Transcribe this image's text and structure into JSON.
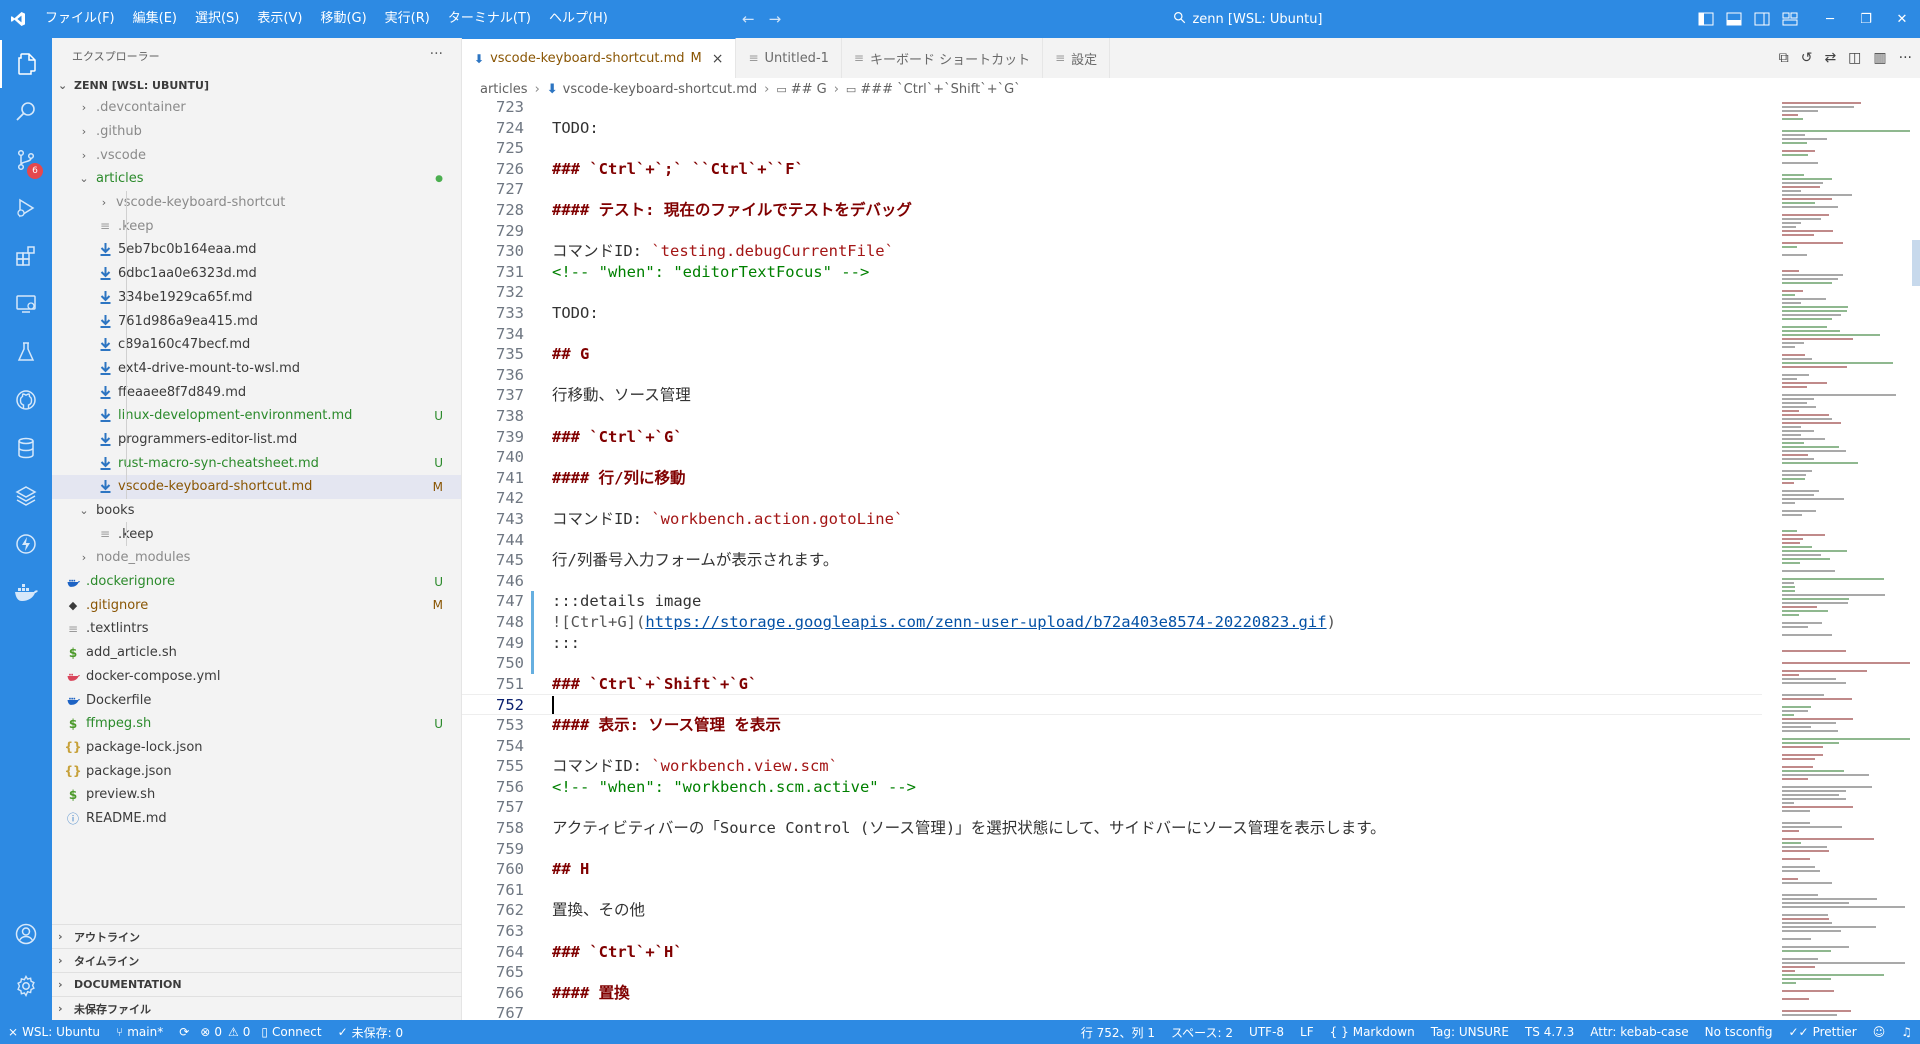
{
  "window": {
    "title": "zenn [WSL: Ubuntu]",
    "menu": [
      "ファイル(F)",
      "編集(E)",
      "選択(S)",
      "表示(V)",
      "移動(G)",
      "実行(R)",
      "ターミナル(T)",
      "ヘルプ(H)"
    ]
  },
  "activity_bar": {
    "items": [
      "explorer-icon",
      "search-icon",
      "source-control-icon",
      "run-debug-icon",
      "extensions-icon",
      "remote-explorer-icon",
      "testing-icon",
      "github-icon",
      "database-icon",
      "layers-icon",
      "thunder-icon",
      "docker-icon"
    ],
    "scm_badge": "6",
    "bottom": [
      "account-icon",
      "settings-gear-icon"
    ]
  },
  "sidebar": {
    "title": "エクスプローラー",
    "more": "···",
    "root": "ZENN [WSL: UBUNTU]",
    "tree": [
      {
        "label": ".devcontainer",
        "type": "folder",
        "open": false,
        "depth": 0,
        "color": "dim"
      },
      {
        "label": ".github",
        "type": "folder",
        "open": false,
        "depth": 0,
        "color": "dim"
      },
      {
        "label": ".vscode",
        "type": "folder",
        "open": false,
        "depth": 0,
        "color": "dim"
      },
      {
        "label": "articles",
        "type": "folder",
        "open": true,
        "depth": 0,
        "color": "green",
        "status": "●"
      },
      {
        "label": "vscode-keyboard-shortcut",
        "type": "folder",
        "open": false,
        "depth": 1,
        "color": "dim"
      },
      {
        "label": ".keep",
        "type": "keep",
        "depth": 1,
        "color": "dim"
      },
      {
        "label": "5eb7bc0b164eaa.md",
        "type": "md",
        "depth": 1,
        "color": "dk"
      },
      {
        "label": "6dbc1aa0e6323d.md",
        "type": "md",
        "depth": 1,
        "color": "dk"
      },
      {
        "label": "334be1929ca65f.md",
        "type": "md",
        "depth": 1,
        "color": "dk"
      },
      {
        "label": "761d986a9ea415.md",
        "type": "md",
        "depth": 1,
        "color": "dk"
      },
      {
        "label": "c89a160c47becf.md",
        "type": "md",
        "depth": 1,
        "color": "dk"
      },
      {
        "label": "ext4-drive-mount-to-wsl.md",
        "type": "md",
        "depth": 1,
        "color": "dk"
      },
      {
        "label": "ffeaaee8f7d849.md",
        "type": "md",
        "depth": 1,
        "color": "dk"
      },
      {
        "label": "linux-development-environment.md",
        "type": "md",
        "depth": 1,
        "color": "green",
        "status": "U"
      },
      {
        "label": "programmers-editor-list.md",
        "type": "md",
        "depth": 1,
        "color": "dk"
      },
      {
        "label": "rust-macro-syn-cheatsheet.md",
        "type": "md",
        "depth": 1,
        "color": "green",
        "status": "U"
      },
      {
        "label": "vscode-keyboard-shortcut.md",
        "type": "md",
        "depth": 1,
        "color": "mod",
        "status": "M",
        "selected": true
      },
      {
        "label": "books",
        "type": "folder",
        "open": true,
        "depth": 0,
        "color": "dk"
      },
      {
        "label": ".keep",
        "type": "keep",
        "depth": 1,
        "color": "dk"
      },
      {
        "label": "node_modules",
        "type": "folder",
        "open": false,
        "depth": 0,
        "color": "dim"
      },
      {
        "label": ".dockerignore",
        "type": "docker",
        "depth": 0,
        "color": "green",
        "status": "U"
      },
      {
        "label": ".gitignore",
        "type": "git",
        "depth": 0,
        "color": "mod",
        "status": "M"
      },
      {
        "label": ".textlintrs",
        "type": "keep",
        "depth": 0,
        "color": "dk"
      },
      {
        "label": "add_article.sh",
        "type": "sh",
        "depth": 0,
        "color": "dk"
      },
      {
        "label": "docker-compose.yml",
        "type": "compose",
        "depth": 0,
        "color": "dk"
      },
      {
        "label": "Dockerfile",
        "type": "docker",
        "depth": 0,
        "color": "dk"
      },
      {
        "label": "ffmpeg.sh",
        "type": "sh",
        "depth": 0,
        "color": "green",
        "status": "U"
      },
      {
        "label": "package-lock.json",
        "type": "json",
        "depth": 0,
        "color": "dk"
      },
      {
        "label": "package.json",
        "type": "json",
        "depth": 0,
        "color": "dk"
      },
      {
        "label": "preview.sh",
        "type": "sh",
        "depth": 0,
        "color": "dk"
      },
      {
        "label": "README.md",
        "type": "info",
        "depth": 0,
        "color": "dk"
      }
    ],
    "sections": [
      "アウトライン",
      "タイムライン",
      "DOCUMENTATION",
      "未保存ファイル"
    ]
  },
  "tabs": [
    {
      "label": "vscode-keyboard-shortcut.md",
      "status": "M",
      "icon": "markdown-icon",
      "active": true,
      "close": "×"
    },
    {
      "label": "Untitled-1",
      "icon": "file-icon",
      "active": false
    },
    {
      "label": "キーボード ショートカット",
      "icon": "keyboard-icon",
      "active": false
    },
    {
      "label": "設定",
      "icon": "settings-icon",
      "active": false
    }
  ],
  "breadcrumb": [
    "articles",
    "vscode-keyboard-shortcut.md",
    "## G",
    "### `Ctrl`+`Shift`+`G`"
  ],
  "editor": {
    "current_line": 752,
    "modified_lines": [
      747,
      748,
      749,
      750
    ],
    "lines": [
      {
        "n": 723,
        "t": "",
        "k": "p"
      },
      {
        "n": 724,
        "t": "TODO:",
        "k": "p"
      },
      {
        "n": 725,
        "t": "",
        "k": "p"
      },
      {
        "n": 726,
        "t": "### `Ctrl`+`;` ``Ctrl`+``F`",
        "k": "h"
      },
      {
        "n": 727,
        "t": "",
        "k": "p"
      },
      {
        "n": 728,
        "t": "#### テスト: 現在のファイルでテストをデバッグ",
        "k": "h"
      },
      {
        "n": 729,
        "t": "",
        "k": "p"
      },
      {
        "n": 730,
        "t": "コマンドID: ",
        "code": "`testing.debugCurrentFile`",
        "k": "cmd"
      },
      {
        "n": 731,
        "t": "<!-- \"when\": \"editorTextFocus\" -->",
        "k": "c"
      },
      {
        "n": 732,
        "t": "",
        "k": "p"
      },
      {
        "n": 733,
        "t": "TODO:",
        "k": "p"
      },
      {
        "n": 734,
        "t": "",
        "k": "p"
      },
      {
        "n": 735,
        "t": "## G",
        "k": "h"
      },
      {
        "n": 736,
        "t": "",
        "k": "p"
      },
      {
        "n": 737,
        "t": "行移動、ソース管理",
        "k": "p"
      },
      {
        "n": 738,
        "t": "",
        "k": "p"
      },
      {
        "n": 739,
        "t": "### `Ctrl`+`G`",
        "k": "h"
      },
      {
        "n": 740,
        "t": "",
        "k": "p"
      },
      {
        "n": 741,
        "t": "#### 行/列に移動",
        "k": "h"
      },
      {
        "n": 742,
        "t": "",
        "k": "p"
      },
      {
        "n": 743,
        "t": "コマンドID: ",
        "code": "`workbench.action.gotoLine`",
        "k": "cmd"
      },
      {
        "n": 744,
        "t": "",
        "k": "p"
      },
      {
        "n": 745,
        "t": "行/列番号入力フォームが表示されます。",
        "k": "p"
      },
      {
        "n": 746,
        "t": "",
        "k": "p"
      },
      {
        "n": 747,
        "t": ":::details image",
        "k": "p"
      },
      {
        "n": 748,
        "t": "![Ctrl+G](",
        "link": "https://storage.googleapis.com/zenn-user-upload/b72a403e8574-20220823.gif",
        "after": ")",
        "k": "img"
      },
      {
        "n": 749,
        "t": ":::",
        "k": "p"
      },
      {
        "n": 750,
        "t": "",
        "k": "p"
      },
      {
        "n": 751,
        "t": "### `Ctrl`+`Shift`+`G`",
        "k": "h"
      },
      {
        "n": 752,
        "t": "",
        "k": "p"
      },
      {
        "n": 753,
        "t": "#### 表示: ソース管理 を表示",
        "k": "h"
      },
      {
        "n": 754,
        "t": "",
        "k": "p"
      },
      {
        "n": 755,
        "t": "コマンドID: ",
        "code": "`workbench.view.scm`",
        "k": "cmd"
      },
      {
        "n": 756,
        "t": "<!-- \"when\": \"workbench.scm.active\" -->",
        "k": "c"
      },
      {
        "n": 757,
        "t": "",
        "k": "p"
      },
      {
        "n": 758,
        "t": "アクティビティバーの「Source Control (ソース管理)」を選択状態にして、サイドバーにソース管理を表示します。",
        "k": "p"
      },
      {
        "n": 759,
        "t": "",
        "k": "p"
      },
      {
        "n": 760,
        "t": "## H",
        "k": "h"
      },
      {
        "n": 761,
        "t": "",
        "k": "p"
      },
      {
        "n": 762,
        "t": "置換、その他",
        "k": "p"
      },
      {
        "n": 763,
        "t": "",
        "k": "p"
      },
      {
        "n": 764,
        "t": "### `Ctrl`+`H`",
        "k": "h"
      },
      {
        "n": 765,
        "t": "",
        "k": "p"
      },
      {
        "n": 766,
        "t": "#### 置換",
        "k": "h"
      },
      {
        "n": 767,
        "t": "",
        "k": "p"
      }
    ]
  },
  "statusbar": {
    "left": [
      {
        "icon": "remote-icon",
        "label": "WSL: Ubuntu"
      },
      {
        "icon": "branch-icon",
        "label": "main*"
      },
      {
        "icon": "sync-icon",
        "label": ""
      },
      {
        "icon": "errors-icon",
        "label": "0"
      },
      {
        "icon": "warnings-icon",
        "label": "0"
      },
      {
        "icon": "connect-icon",
        "label": "Connect"
      },
      {
        "icon": "check-icon",
        "label": "未保存: 0"
      }
    ],
    "right": [
      "行 752、列 1",
      "スペース: 2",
      "UTF-8",
      "LF",
      "Markdown",
      "Tag: UNSURE",
      "TS 4.7.3",
      "Attr: kebab-case",
      "No tsconfig",
      "Prettier"
    ],
    "right_icons": [
      "markdown-braces-icon",
      "check-double-icon",
      "feedback-icon",
      "bell-icon"
    ]
  },
  "colors": {
    "accent": "#2d8ae3",
    "git_untracked": "#2b8a2b",
    "git_modified": "#895503",
    "heading": "#800000",
    "string": "#a31515",
    "comment": "#008000",
    "link": "#0451a5"
  }
}
